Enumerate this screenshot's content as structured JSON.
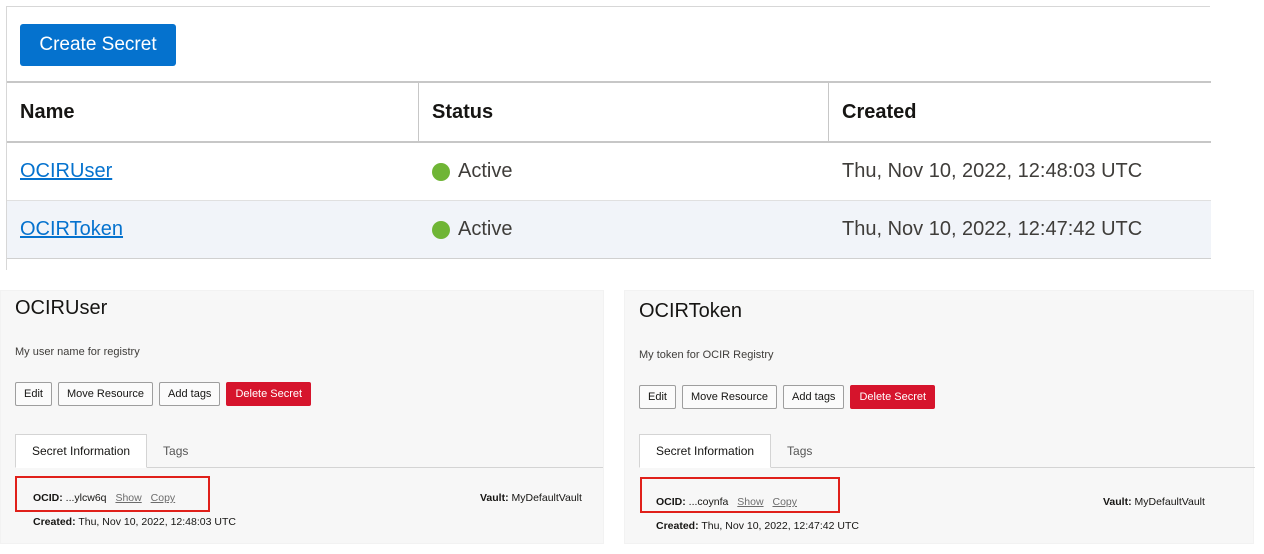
{
  "table": {
    "create_label": "Create Secret",
    "columns": [
      "Name",
      "Status",
      "Created"
    ],
    "rows": [
      {
        "name": "OCIRUser",
        "status": "Active",
        "created": "Thu, Nov 10, 2022, 12:48:03 UTC"
      },
      {
        "name": "OCIRToken",
        "status": "Active",
        "created": "Thu, Nov 10, 2022, 12:47:42 UTC"
      }
    ],
    "status_color": "#6fb535",
    "accent": "#0572ce"
  },
  "details": [
    {
      "title": "OCIRUser",
      "description": "My user name for registry",
      "buttons": [
        "Edit",
        "Move Resource",
        "Add tags",
        "Delete Secret"
      ],
      "tabs": [
        "Secret Information",
        "Tags"
      ],
      "ocid_label": "OCID:",
      "ocid_value": "...ylcw6q",
      "show_label": "Show",
      "copy_label": "Copy",
      "vault_label": "Vault:",
      "vault_value": "MyDefaultVault",
      "created_label": "Created:",
      "created_value": "Thu, Nov 10, 2022, 12:48:03 UTC"
    },
    {
      "title": "OCIRToken",
      "description": "My token for OCIR Registry",
      "buttons": [
        "Edit",
        "Move Resource",
        "Add tags",
        "Delete Secret"
      ],
      "tabs": [
        "Secret Information",
        "Tags"
      ],
      "ocid_label": "OCID:",
      "ocid_value": "...coynfa",
      "show_label": "Show",
      "copy_label": "Copy",
      "vault_label": "Vault:",
      "vault_value": "MyDefaultVault",
      "created_label": "Created:",
      "created_value": "Thu, Nov 10, 2022, 12:47:42 UTC"
    }
  ],
  "danger_color": "#d6142c",
  "highlight_color": "#e0201a"
}
